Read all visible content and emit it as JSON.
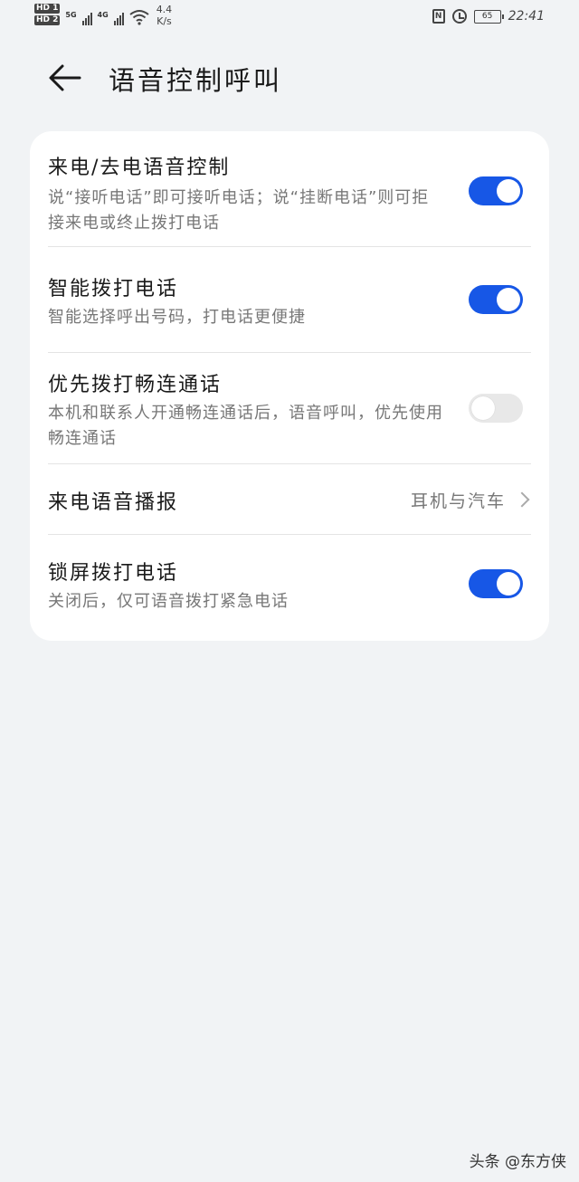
{
  "status_bar": {
    "hd1": "HD 1",
    "hd2": "HD 2",
    "net1": "5G",
    "net2": "4G",
    "speed_value": "4.4",
    "speed_unit": "K/s",
    "nfc": "N",
    "battery": "65",
    "time": "22:41"
  },
  "header": {
    "title": "语音控制呼叫"
  },
  "settings": {
    "incoming_voice_control": {
      "title": "来电/去电语音控制",
      "subtitle": "说“接听电话”即可接听电话；说“挂断电话”则可拒接来电或终止拨打电话",
      "enabled": true
    },
    "smart_dial": {
      "title": "智能拨打电话",
      "subtitle": "智能选择呼出号码，打电话更便捷",
      "enabled": true
    },
    "changlian_priority": {
      "title": "优先拨打畅连通话",
      "subtitle": "本机和联系人开通畅连通话后，语音呼叫，优先使用畅连通话",
      "enabled": false
    },
    "incoming_announce": {
      "title": "来电语音播报",
      "value": "耳机与汽车"
    },
    "lockscreen_dial": {
      "title": "锁屏拨打电话",
      "subtitle": "关闭后，仅可语音拨打紧急电话",
      "enabled": true
    }
  },
  "colors": {
    "accent": "#1757e6",
    "background": "#f1f3f5",
    "card": "#ffffff"
  },
  "watermark": "头条 @东方侠"
}
